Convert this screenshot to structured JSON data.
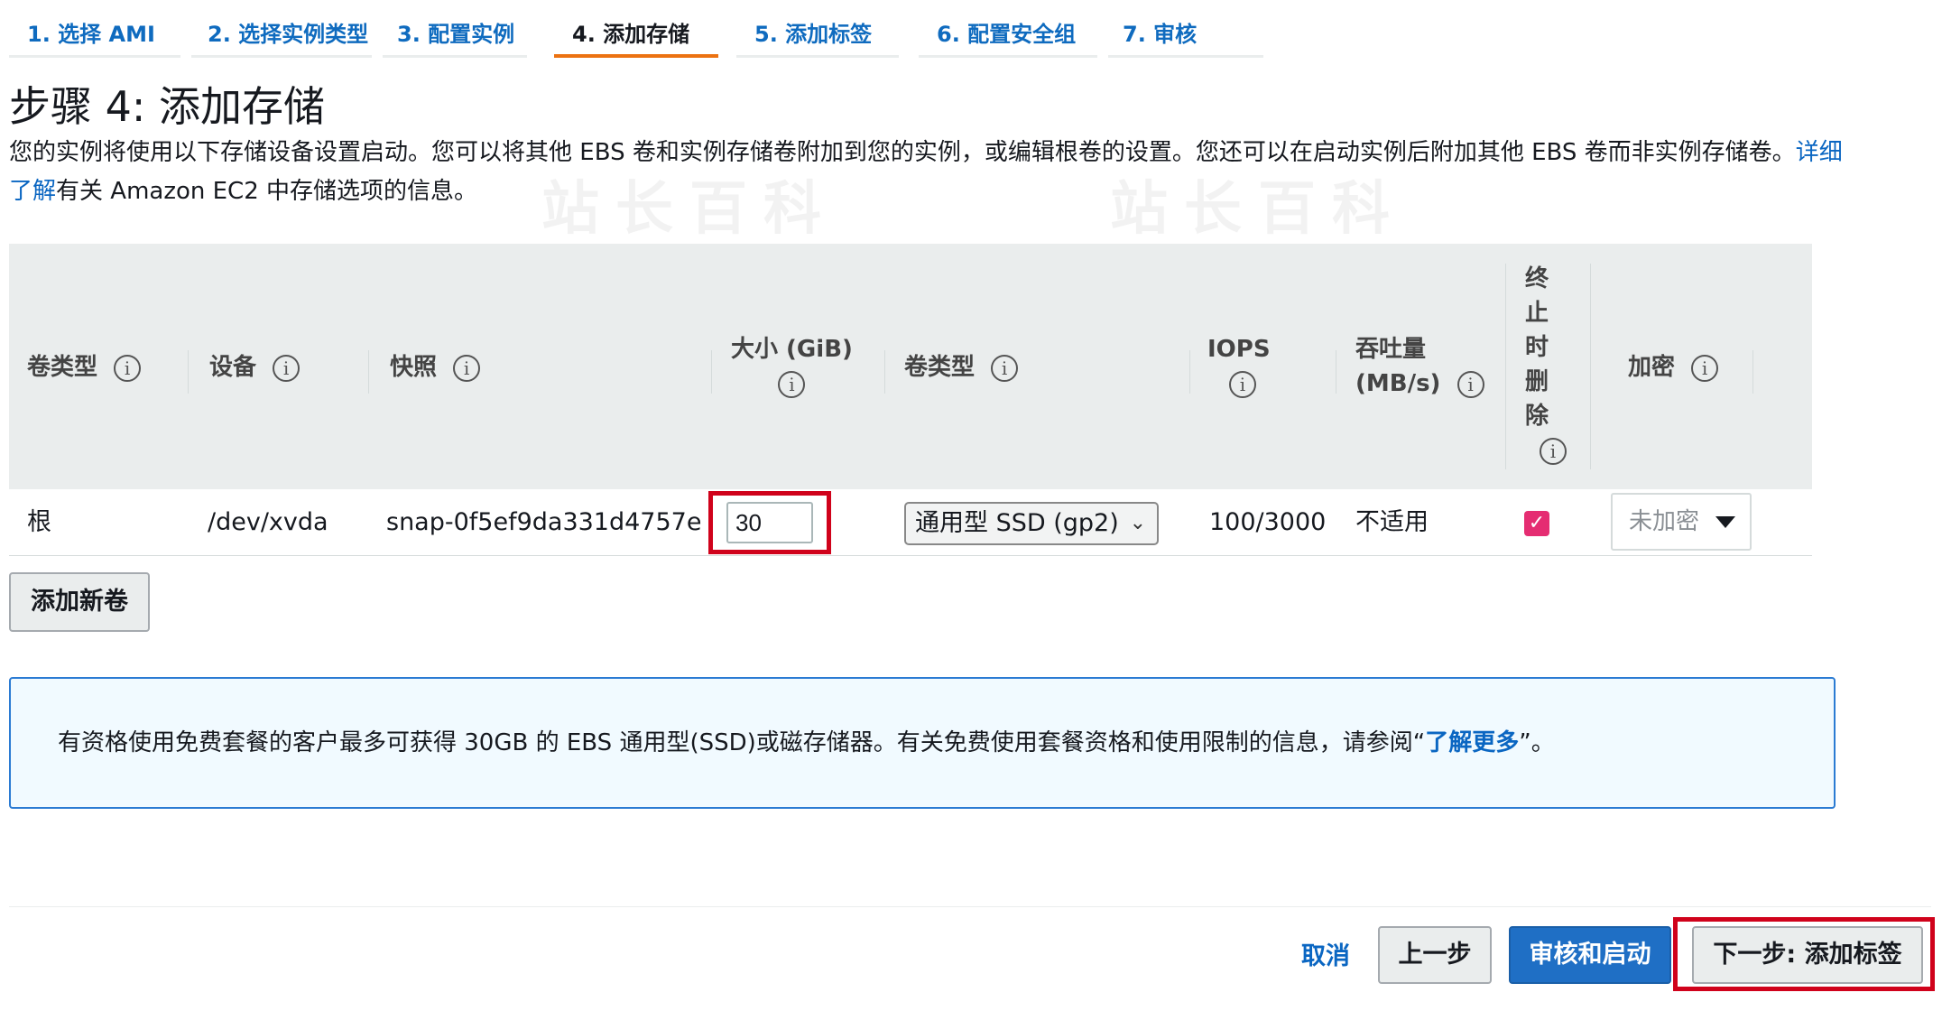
{
  "wizard": {
    "steps": [
      {
        "label": "1. 选择 AMI"
      },
      {
        "label": "2. 选择实例类型"
      },
      {
        "label": "3. 配置实例"
      },
      {
        "label": "4. 添加存储"
      },
      {
        "label": "5. 添加标签"
      },
      {
        "label": "6. 配置安全组"
      },
      {
        "label": "7. 审核"
      }
    ],
    "active_index": 3
  },
  "page": {
    "title": "步骤 4: 添加存储",
    "description_part1": "您的实例将使用以下存储设备设置启动。您可以将其他 EBS 卷和实例存储卷附加到您的实例，或编辑根卷的设置。您还可以在启动实例后附加其他 EBS 卷而非实例存储卷。",
    "learn_more_link": "详细了解",
    "description_part2": "有关 Amazon EC2 中存储选项的信息。"
  },
  "table": {
    "headers": {
      "volume_type": "卷类型",
      "device": "设备",
      "snapshot": "快照",
      "size": "大小 (GiB)",
      "ebs_type": "卷类型",
      "iops": "IOPS",
      "throughput_line1": "吞吐量",
      "throughput_line2": "(MB/s)",
      "delete_on_termination": [
        "终",
        "止",
        "时",
        "删",
        "除"
      ],
      "encryption": "加密"
    },
    "info_icon": "i",
    "row": {
      "volume_type": "根",
      "device": "/dev/xvda",
      "snapshot": "snap-0f5ef9da331d4757e",
      "size": "30",
      "ebs_type": "通用型 SSD (gp2)",
      "iops": "100/3000",
      "throughput": "不适用",
      "delete_on_termination": true,
      "encryption": "未加密"
    }
  },
  "buttons": {
    "add_volume": "添加新卷",
    "cancel": "取消",
    "previous": "上一步",
    "review_launch": "审核和启动",
    "next": "下一步: 添加标签"
  },
  "info_box": {
    "text_part1": "有资格使用免费套餐的客户最多可获得 30GB 的 EBS 通用型(SSD)或磁存储器。有关免费使用套餐资格和使用限制的信息，请参阅“",
    "link": "了解更多",
    "text_part2": "”。"
  },
  "icons": {
    "info": "info-circle-icon",
    "checkbox": "checkmark-icon",
    "dropdown": "chevron-down-icon",
    "caret": "caret-down-icon"
  },
  "colors": {
    "accent_active_tab": "#ec7211",
    "link": "#0a66c2",
    "primary_button": "#1f6fc5",
    "checkbox": "#e52d72",
    "highlight": "#d0021b"
  }
}
